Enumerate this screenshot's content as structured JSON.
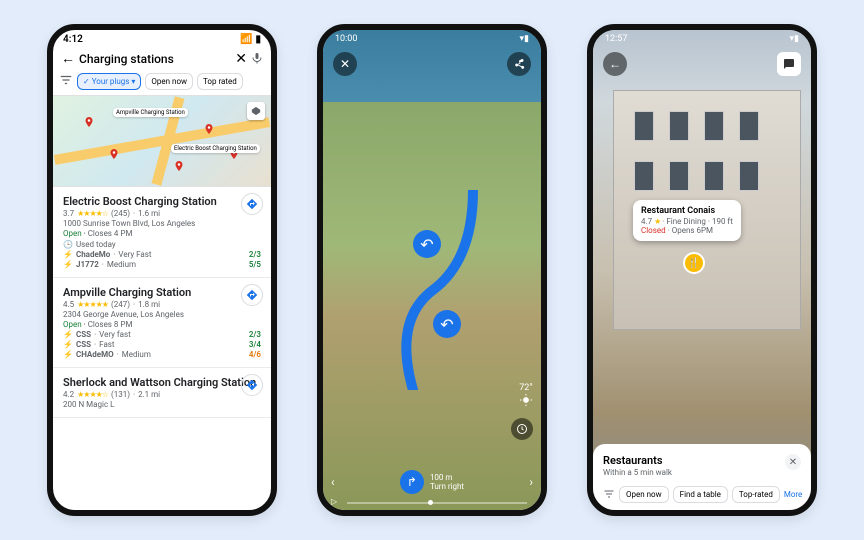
{
  "phone1": {
    "status_time": "4:12",
    "search_query": "Charging stations",
    "filters": {
      "your_plugs": "Your plugs",
      "open_now": "Open now",
      "top_rated": "Top rated"
    },
    "map_labels": {
      "ampville": "Ampville Charging Station",
      "electric_boost": "Electric Boost Charging Station"
    },
    "results": [
      {
        "name": "Electric Boost Charging Station",
        "rating": "3.7",
        "reviews": "(245)",
        "distance": "1.6 mi",
        "address": "1000 Sunrise Town Blvd, Los Angeles",
        "open_state": "Open",
        "closes": "Closes 4 PM",
        "used": "Used today",
        "plugs": [
          {
            "type": "ChadeMo",
            "speed": "Very Fast",
            "avail": "2/3",
            "cls": "good"
          },
          {
            "type": "J1772",
            "speed": "Medium",
            "avail": "5/5",
            "cls": "good"
          }
        ]
      },
      {
        "name": "Ampville Charging Station",
        "rating": "4.5",
        "reviews": "(247)",
        "distance": "1.8 mi",
        "address": "2304 George Avenue, Los Angeles",
        "open_state": "Open",
        "closes": "Closes 8 PM",
        "plugs": [
          {
            "type": "CSS",
            "speed": "Very fast",
            "avail": "2/3",
            "cls": "good"
          },
          {
            "type": "CSS",
            "speed": "Fast",
            "avail": "3/4",
            "cls": "good"
          },
          {
            "type": "CHAdeMO",
            "speed": "Medium",
            "avail": "4/6",
            "cls": "mid"
          }
        ]
      },
      {
        "name": "Sherlock and Wattson Charging Station",
        "rating": "4.2",
        "reviews": "(131)",
        "distance": "2.1 mi",
        "address": "200 N Magic L"
      }
    ]
  },
  "phone2": {
    "status_time": "10:00",
    "temperature": "72°",
    "instruction_distance": "100 m",
    "instruction_text": "Turn right"
  },
  "phone3": {
    "status_time": "12:57",
    "poi": {
      "name": "Restaurant Conais",
      "rating": "4.7",
      "category": "Fine Dining",
      "distance": "190 ft",
      "state": "Closed",
      "opens": "Opens 6PM"
    },
    "sheet": {
      "title": "Restaurants",
      "subtitle": "Within a 5 min walk",
      "chips": {
        "open_now": "Open now",
        "find_table": "Find a table",
        "top_rated": "Top-rated",
        "more": "More"
      }
    }
  }
}
